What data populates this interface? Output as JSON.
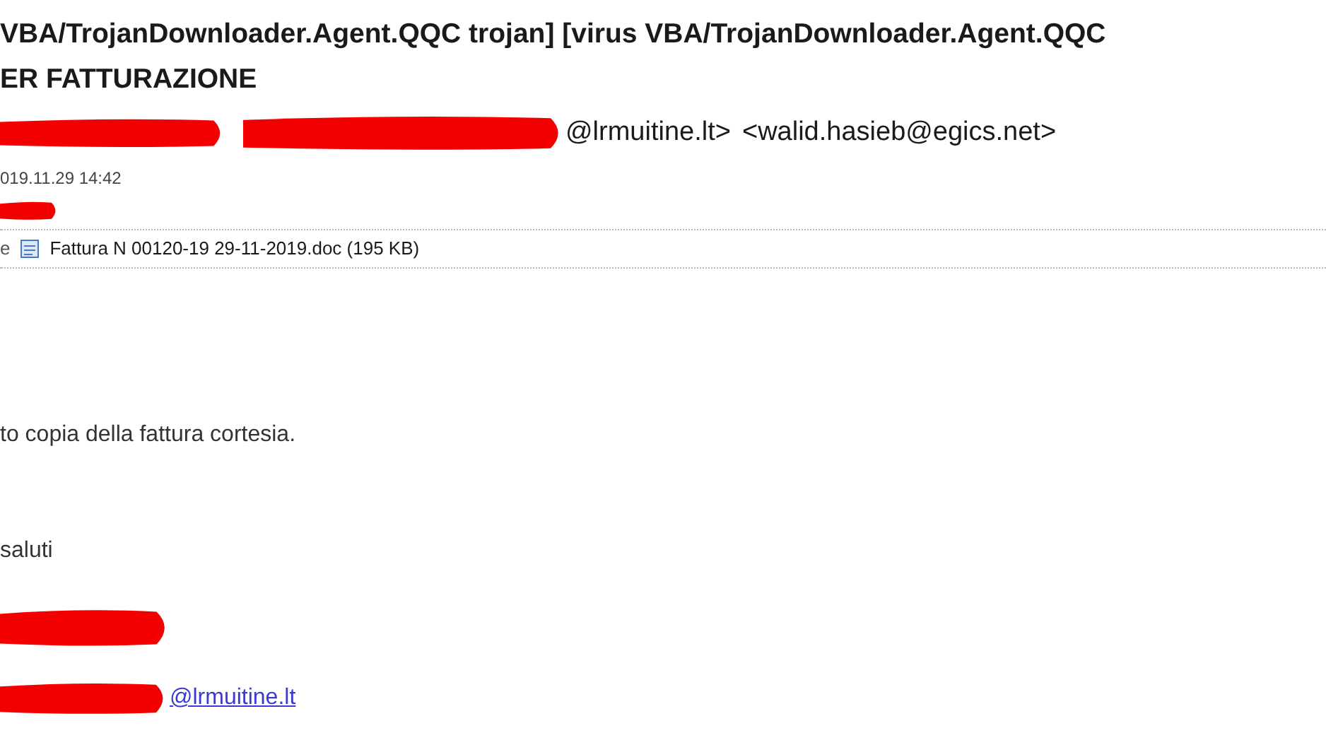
{
  "subject": {
    "lines": [
      "VBA/TrojanDownloader.Agent.QQC trojan] [virus VBA/TrojanDownloader.Agent.QQC",
      "ER FATTURAZIONE"
    ]
  },
  "from": {
    "sender_tail": "@lrmuitine.lt>",
    "recipient": "<walid.hasieb@egics.net>"
  },
  "date": "019.11.29 14:42",
  "attachment": {
    "label_tail": "e",
    "file": "Fattura N 00120-19 29-11-2019.doc (195 KB)"
  },
  "body": {
    "lines": [
      "to copia della fattura cortesia.",
      "saluti"
    ],
    "signature_link": "@lrmuitine.lt"
  }
}
